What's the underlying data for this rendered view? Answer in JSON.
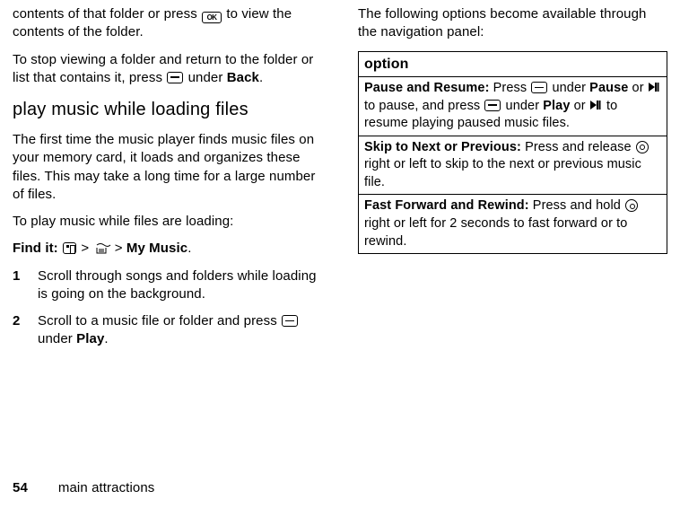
{
  "left": {
    "intro_part1": "contents of that folder or press ",
    "intro_part2": " to view the contents of the folder.",
    "stopview_1": "To stop viewing a folder and return to the folder or list that contains it, press ",
    "stopview_2": " under ",
    "stopview_back": "Back",
    "stopview_3": ".",
    "heading": "play music while loading files",
    "first_time": "The first time the music player finds music files on your memory card, it loads and organizes these files. This may take a long time for a large number of files.",
    "toplay": "To play music while files are loading:",
    "findit_label": "Find it:",
    "findit_sep": " > ",
    "findit_mymusic": "My Music",
    "step1": "Scroll through songs and folders while loading is going on the background.",
    "step2_a": "Scroll to a music file or folder and press ",
    "step2_b": " under ",
    "step2_play": "Play",
    "step2_c": "."
  },
  "right": {
    "intro": "The following options become available through the navigation panel:",
    "header": "option",
    "row1": {
      "title": "Pause and Resume:",
      "a": " Press ",
      "b": " under ",
      "pause": "Pause",
      "c": " or ",
      "d": " to pause, and press ",
      "e": " under ",
      "play": "Play",
      "f": " or ",
      "g": " to resume playing paused music files."
    },
    "row2": {
      "title": "Skip to Next or Previous:",
      "a": " Press and release ",
      "b": " right or left to skip to the next or previous music file."
    },
    "row3": {
      "title": "Fast Forward and Rewind:",
      "a": " Press and hold ",
      "b": " right or left for 2 seconds to fast forward or to rewind."
    }
  },
  "footer": {
    "page": "54",
    "section": "main attractions"
  }
}
